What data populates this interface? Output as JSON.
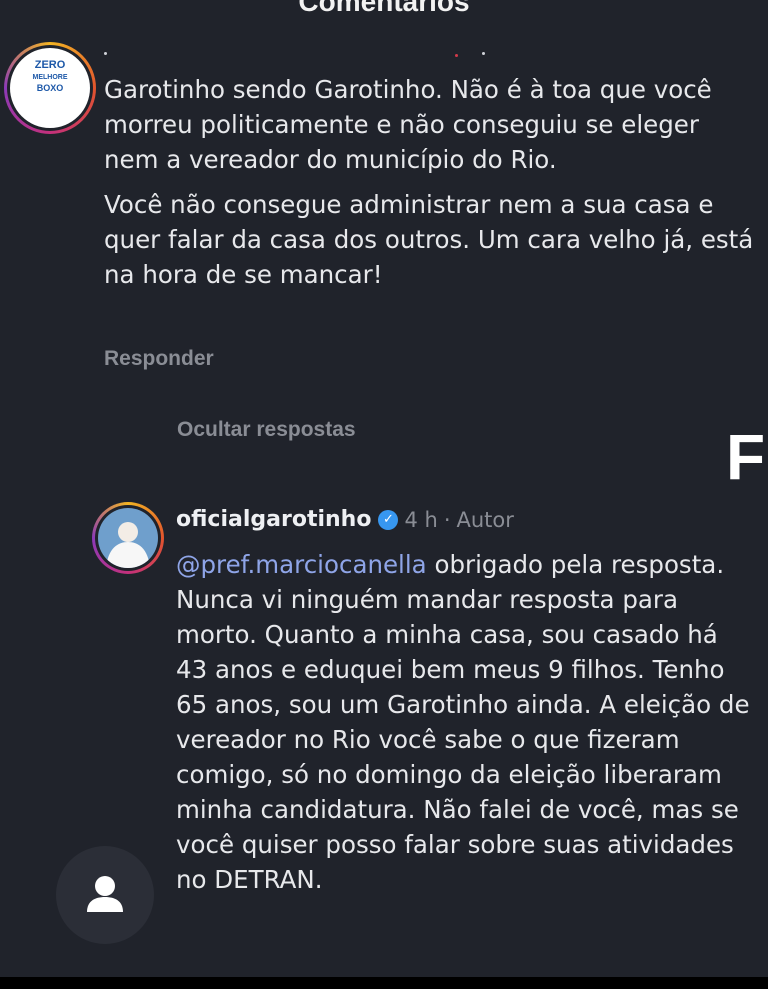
{
  "header": {
    "title": "Comentários"
  },
  "comment": {
    "avatar_logo_lines": [
      "ZERO",
      "MELHORE",
      "BOXO"
    ],
    "paragraph1": "Garotinho sendo Garotinho.  Não é à toa que você morreu politicamente e não conseguiu se eleger nem a vereador do município do Rio.",
    "paragraph2": "Você não consegue administrar nem a sua casa e quer falar da casa dos outros. Um cara velho já, está na hora de se mancar!",
    "reply_label": "Responder"
  },
  "hide_replies_label": "Ocultar respostas",
  "reply": {
    "username": "oficialgarotinho",
    "verified_glyph": "✓",
    "time": "4 h",
    "separator": "·",
    "author_label": "Autor",
    "mention": "@pref.marciocanella",
    "text": " obrigado pela resposta. Nunca vi ninguém mandar resposta para morto. Quanto a minha casa, sou casado há 43 anos e eduquei bem meus 9 filhos. Tenho 65 anos, sou um Garotinho ainda. A eleição de vereador no Rio você sabe o que fizeram comigo, só no domingo da eleição liberaram minha candidatura. Não falei de você, mas se você quiser posso falar sobre suas atividades no DETRAN."
  },
  "side_letter": "F",
  "icons": {
    "profile": "person-icon",
    "verified": "verified-badge-icon"
  },
  "colors": {
    "background": "#20232b",
    "mention": "#8fa5e8",
    "verified": "#3797f0",
    "muted": "#8a8d95"
  }
}
